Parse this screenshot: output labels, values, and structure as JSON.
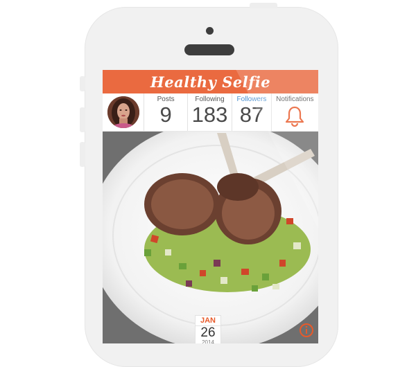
{
  "app": {
    "title": "Healthy Selfie",
    "accent_color": "#ea6a40"
  },
  "profile": {
    "avatar": "user-avatar-photo"
  },
  "stats": {
    "posts": {
      "label": "Posts",
      "value": "9"
    },
    "following": {
      "label": "Following",
      "value": "183"
    },
    "followers": {
      "label": "Followers",
      "value": "87"
    },
    "notifications": {
      "label": "Notifications",
      "icon": "bell-icon"
    }
  },
  "post": {
    "image": "food-photo-lamb-chops-vegetable-salad",
    "date": {
      "month": "JAN",
      "day": "26",
      "year": "2014"
    },
    "info_icon": "info-icon"
  }
}
